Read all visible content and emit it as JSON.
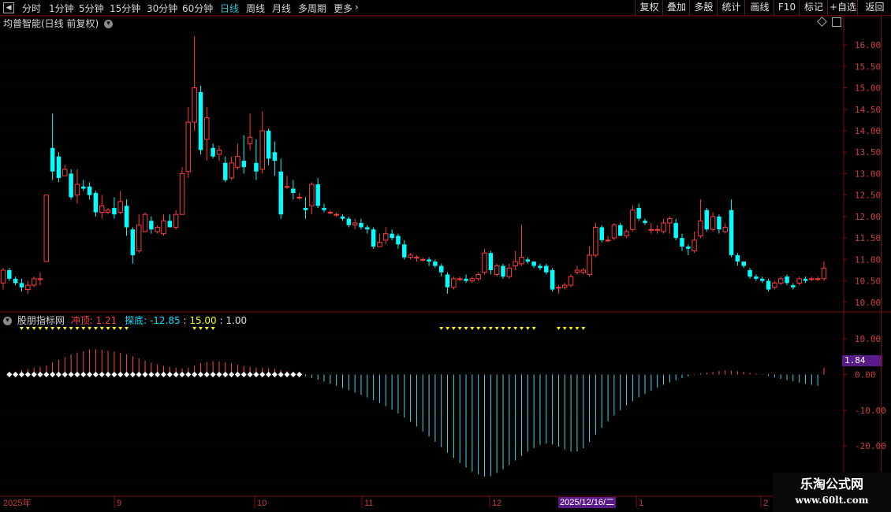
{
  "toolbar": {
    "periods": [
      "分时",
      "1分钟",
      "5分钟",
      "15分钟",
      "30分钟",
      "60分钟",
      "日线",
      "周线",
      "月线",
      "多周期",
      "更多"
    ],
    "active_period": "日线",
    "more_arrow": "›",
    "right_buttons": [
      "复权",
      "叠加",
      "多股",
      "统计",
      "画线",
      "F10",
      "标记",
      "+自选",
      "返回"
    ]
  },
  "main_panel": {
    "title": "均普智能(日线 前复权)",
    "y_ticks": [
      "16.00",
      "15.50",
      "15.00",
      "14.50",
      "14.00",
      "13.50",
      "13.00",
      "12.50",
      "12.00",
      "11.50",
      "11.00",
      "10.50",
      "10.00"
    ]
  },
  "indicator_panel": {
    "name": "股朋指标网",
    "label1": "冲顶:",
    "value1": "1.21",
    "label2": "探底:",
    "value2": "-12.85",
    "value3": ": 15.00",
    "value4": ": 1.00",
    "y_ticks": [
      "10.00",
      "0.00",
      "-10.00",
      "-20.00",
      "-30.00"
    ],
    "current_value": "1.84"
  },
  "x_axis": {
    "labels": [
      "2025年",
      "9",
      "10",
      "11",
      "12",
      "1",
      "2"
    ],
    "cursor_date": "2025/12/16/二"
  },
  "watermark": {
    "line1": "乐淘公式网",
    "line2": "www.60lt.com"
  },
  "colors": {
    "up": "#ff3c3c",
    "down": "#00ffff",
    "grid": "#3a0000",
    "frame": "#7a1010",
    "axis_text": "#c84040",
    "yellow": "#ffff00",
    "active_tab": "#27c6d6"
  },
  "chart_data": {
    "type": "candlestick",
    "y_range": [
      9.85,
      16.35
    ],
    "candles": [
      [
        10.45,
        10.75,
        10.8,
        10.3
      ],
      [
        10.75,
        10.55,
        10.8,
        10.5
      ],
      [
        10.55,
        10.45,
        10.6,
        10.4
      ],
      [
        10.45,
        10.35,
        10.55,
        10.25
      ],
      [
        10.3,
        10.4,
        10.5,
        10.2
      ],
      [
        10.4,
        10.55,
        10.6,
        10.35
      ],
      [
        10.55,
        10.55,
        10.7,
        10.4
      ],
      [
        10.95,
        12.5,
        12.5,
        10.95
      ],
      [
        13.6,
        13.05,
        14.4,
        12.85
      ],
      [
        13.4,
        12.9,
        13.5,
        12.8
      ],
      [
        12.95,
        13.1,
        13.2,
        12.95
      ],
      [
        13.0,
        12.45,
        13.1,
        12.4
      ],
      [
        12.5,
        12.75,
        13.1,
        12.3
      ],
      [
        12.7,
        12.65,
        12.85,
        12.6
      ],
      [
        12.7,
        12.5,
        12.8,
        12.4
      ],
      [
        12.55,
        12.1,
        12.6,
        12.0
      ],
      [
        12.1,
        12.25,
        12.5,
        11.95
      ],
      [
        12.1,
        12.15,
        12.2,
        12.05
      ],
      [
        12.2,
        12.05,
        12.45,
        11.95
      ],
      [
        12.1,
        12.35,
        12.6,
        12.05
      ],
      [
        12.25,
        11.75,
        12.4,
        11.55
      ],
      [
        11.7,
        11.1,
        11.75,
        10.9
      ],
      [
        11.2,
        11.8,
        12.05,
        11.15
      ],
      [
        11.65,
        12.05,
        12.1,
        11.65
      ],
      [
        11.9,
        11.7,
        12.0,
        11.6
      ],
      [
        11.65,
        11.75,
        11.8,
        11.6
      ],
      [
        11.6,
        11.9,
        12.05,
        11.55
      ],
      [
        11.9,
        11.75,
        12.05,
        11.75
      ],
      [
        11.75,
        12.05,
        12.15,
        11.7
      ],
      [
        12.05,
        13.0,
        13.15,
        12.05
      ],
      [
        13.05,
        14.2,
        14.55,
        12.9
      ],
      [
        14.2,
        15.0,
        16.2,
        14.0
      ],
      [
        14.9,
        13.55,
        15.05,
        13.45
      ],
      [
        13.8,
        14.3,
        14.55,
        13.3
      ],
      [
        13.6,
        13.4,
        13.7,
        13.35
      ],
      [
        13.45,
        13.55,
        13.65,
        13.3
      ],
      [
        13.25,
        12.85,
        13.4,
        12.8
      ],
      [
        12.9,
        13.25,
        13.4,
        12.85
      ],
      [
        13.15,
        13.4,
        13.7,
        13.1
      ],
      [
        13.3,
        13.15,
        13.9,
        13.0
      ],
      [
        13.7,
        13.85,
        14.4,
        13.55
      ],
      [
        13.25,
        13.05,
        13.8,
        12.85
      ],
      [
        13.1,
        14.0,
        14.45,
        13.0
      ],
      [
        14.0,
        13.35,
        14.05,
        13.2
      ],
      [
        13.5,
        13.3,
        13.75,
        12.95
      ],
      [
        13.05,
        12.05,
        13.35,
        11.95
      ],
      [
        12.7,
        12.7,
        12.95,
        12.65
      ],
      [
        12.65,
        12.55,
        12.85,
        12.4
      ],
      [
        12.45,
        12.45,
        12.55,
        12.4
      ],
      [
        12.2,
        12.15,
        12.45,
        11.95
      ],
      [
        12.25,
        12.75,
        12.8,
        12.05
      ],
      [
        12.75,
        12.25,
        12.9,
        12.2
      ],
      [
        12.2,
        12.15,
        12.3,
        12.1
      ],
      [
        12.1,
        12.1,
        12.15,
        12.05
      ],
      [
        12.05,
        12.05,
        12.1,
        12.0
      ],
      [
        12.0,
        11.95,
        12.05,
        11.9
      ],
      [
        11.95,
        11.8,
        12.0,
        11.75
      ],
      [
        11.8,
        11.85,
        11.95,
        11.7
      ],
      [
        11.85,
        11.75,
        11.95,
        11.7
      ],
      [
        11.75,
        11.7,
        11.8,
        11.6
      ],
      [
        11.7,
        11.3,
        11.75,
        11.25
      ],
      [
        11.3,
        11.4,
        11.6,
        11.3
      ],
      [
        11.45,
        11.6,
        11.75,
        11.35
      ],
      [
        11.6,
        11.5,
        11.7,
        11.45
      ],
      [
        11.55,
        11.35,
        11.6,
        11.25
      ],
      [
        11.35,
        11.05,
        11.45,
        11.0
      ],
      [
        11.05,
        11.1,
        11.15,
        11.0
      ],
      [
        11.05,
        11.05,
        11.1,
        10.95
      ],
      [
        11.0,
        11.0,
        11.05,
        10.95
      ],
      [
        11.0,
        10.95,
        11.05,
        10.85
      ],
      [
        10.95,
        10.85,
        11.0,
        10.8
      ],
      [
        10.85,
        10.7,
        10.9,
        10.6
      ],
      [
        10.65,
        10.35,
        10.7,
        10.2
      ],
      [
        10.35,
        10.55,
        10.6,
        10.3
      ],
      [
        10.55,
        10.55,
        10.6,
        10.5
      ],
      [
        10.55,
        10.5,
        10.65,
        10.45
      ],
      [
        10.5,
        10.55,
        10.6,
        10.45
      ],
      [
        10.55,
        10.65,
        10.7,
        10.5
      ],
      [
        10.7,
        11.15,
        11.25,
        10.65
      ],
      [
        11.15,
        10.75,
        11.2,
        10.65
      ],
      [
        10.65,
        10.85,
        10.9,
        10.6
      ],
      [
        10.85,
        10.6,
        10.9,
        10.55
      ],
      [
        10.6,
        10.8,
        10.9,
        10.55
      ],
      [
        10.85,
        10.95,
        11.2,
        10.75
      ],
      [
        10.9,
        11.05,
        11.8,
        10.85
      ],
      [
        11.0,
        10.95,
        11.05,
        10.9
      ],
      [
        10.95,
        10.85,
        10.95,
        10.8
      ],
      [
        10.85,
        10.8,
        10.9,
        10.75
      ],
      [
        10.85,
        10.7,
        10.9,
        10.65
      ],
      [
        10.75,
        10.3,
        10.8,
        10.25
      ],
      [
        10.35,
        10.35,
        10.4,
        10.2
      ],
      [
        10.35,
        10.4,
        10.45,
        10.3
      ],
      [
        10.4,
        10.6,
        10.65,
        10.35
      ],
      [
        10.7,
        10.75,
        10.85,
        10.65
      ],
      [
        10.7,
        10.75,
        10.8,
        10.65
      ],
      [
        10.65,
        11.1,
        11.3,
        10.6
      ],
      [
        11.1,
        11.75,
        11.85,
        11.05
      ],
      [
        11.75,
        11.45,
        11.8,
        11.4
      ],
      [
        11.45,
        11.45,
        11.55,
        11.4
      ],
      [
        11.5,
        11.8,
        11.85,
        11.45
      ],
      [
        11.8,
        11.55,
        11.85,
        11.55
      ],
      [
        11.55,
        11.65,
        11.7,
        11.5
      ],
      [
        11.7,
        12.15,
        12.25,
        11.65
      ],
      [
        12.2,
        11.95,
        12.3,
        11.9
      ],
      [
        11.9,
        11.85,
        11.95,
        11.8
      ],
      [
        11.7,
        11.7,
        11.85,
        11.6
      ],
      [
        11.7,
        11.7,
        11.8,
        11.6
      ],
      [
        11.65,
        11.85,
        11.95,
        11.6
      ],
      [
        11.85,
        11.95,
        12.0,
        11.6
      ],
      [
        11.85,
        11.5,
        11.95,
        11.45
      ],
      [
        11.5,
        11.3,
        11.6,
        11.2
      ],
      [
        11.3,
        11.25,
        11.35,
        11.1
      ],
      [
        11.2,
        11.45,
        11.65,
        11.15
      ],
      [
        11.55,
        11.9,
        12.4,
        11.5
      ],
      [
        12.15,
        11.7,
        12.2,
        11.65
      ],
      [
        11.7,
        12.0,
        12.1,
        11.65
      ],
      [
        12.0,
        11.7,
        12.05,
        11.6
      ],
      [
        11.65,
        11.75,
        11.85,
        11.6
      ],
      [
        12.15,
        11.1,
        12.4,
        11.05
      ],
      [
        11.1,
        10.95,
        11.15,
        10.85
      ],
      [
        10.95,
        10.85,
        10.95,
        10.8
      ],
      [
        10.75,
        10.6,
        10.8,
        10.55
      ],
      [
        10.6,
        10.55,
        10.65,
        10.5
      ],
      [
        10.55,
        10.5,
        10.6,
        10.45
      ],
      [
        10.5,
        10.3,
        10.55,
        10.25
      ],
      [
        10.35,
        10.45,
        10.5,
        10.3
      ],
      [
        10.45,
        10.55,
        10.6,
        10.4
      ],
      [
        10.6,
        10.45,
        10.65,
        10.4
      ],
      [
        10.4,
        10.35,
        10.45,
        10.3
      ],
      [
        10.45,
        10.55,
        10.6,
        10.4
      ],
      [
        10.55,
        10.5,
        10.6,
        10.45
      ],
      [
        10.55,
        10.55,
        10.6,
        10.5
      ],
      [
        10.55,
        10.55,
        10.6,
        10.5
      ],
      [
        10.55,
        10.8,
        10.95,
        10.5
      ]
    ],
    "indicator_series": [
      {
        "name": "冲顶",
        "values": [
          1.21,
          2.1,
          2.38,
          2.62,
          2.53,
          2.83,
          2.56,
          3.39,
          4.85,
          5.44,
          5.56,
          6.22,
          6.09,
          6.06,
          6.34,
          4.96,
          4.37,
          3.35,
          3.22,
          3.13,
          2.94,
          2.2,
          1.52,
          0.92,
          0.56,
          0.41,
          0.67,
          0.95,
          1.17,
          1.72,
          2.32,
          3.08,
          3.19,
          3.1,
          2.54,
          1.84,
          1.22,
          0.73,
          0.41,
          0.36,
          0.46,
          0.8,
          1.16,
          1.2,
          1.07,
          0.77,
          0.49,
          0.37,
          0.35,
          0.46,
          0.61,
          0.56,
          0.38,
          0.11,
          -0.26,
          -0.53,
          -0.82,
          -1.13,
          -1.23,
          -1.44,
          -1.81,
          -2.31,
          -2.74,
          -3.25,
          -3.78,
          -4.44,
          -5.19,
          -5.98,
          -6.84,
          -7.73,
          -8.6,
          -9.61,
          -10.78,
          -12.02,
          -13.18,
          -14.08,
          -14.89,
          -15.47,
          -15.55,
          -14.84,
          -14.08,
          -13.62,
          -12.85,
          -11.82,
          -10.89,
          -10.31,
          -10.08,
          -10.34,
          -11.13,
          -12.32,
          -13.33,
          -13.97,
          -14.01,
          -13.22,
          -11.78,
          -9.95,
          -8.24,
          -6.79,
          -5.75,
          -4.94,
          -4.48,
          -4.22,
          -4.11,
          -4.18,
          -4.31,
          -4.42,
          -4.45,
          -4.34,
          -4.15,
          -4.06,
          -4.01,
          -3.98,
          -3.99,
          -4.09,
          -4.13,
          -4.15,
          -4.11,
          -4.08,
          -4.03,
          -4.08,
          -4.06,
          -4.09,
          -4.26,
          -4.56,
          -4.96,
          -5.47,
          -5.93,
          -6.39,
          -6.88,
          -7.42,
          -7.69,
          -7.86,
          -7.91,
          -1.75
        ]
      },
      {
        "name": "探底",
        "values": [
          -0.01,
          0.31,
          0.77,
          1.23,
          1.52,
          1.87,
          2.12,
          2.54,
          3.38,
          4.11,
          4.86,
          5.6,
          6.15,
          6.55,
          7.08,
          7.1,
          6.96,
          6.68,
          6.4,
          6.06,
          5.66,
          5.14,
          4.56,
          3.92,
          3.34,
          2.88,
          2.42,
          2.14,
          1.88,
          1.71,
          1.93,
          2.44,
          3.18,
          3.56,
          3.69,
          3.62,
          3.45,
          3.13,
          2.75,
          2.37,
          2.12,
          1.92,
          1.91,
          1.8,
          1.65,
          1.31,
          0.91,
          0.46,
          0.01,
          -0.5,
          -0.98,
          -1.46,
          -1.99,
          -2.54,
          -3.15,
          -3.77,
          -4.41,
          -5.05,
          -5.71,
          -6.44,
          -7.19,
          -7.98,
          -8.83,
          -9.82,
          -10.92,
          -12.06,
          -13.28,
          -14.58,
          -15.95,
          -17.37,
          -18.84,
          -20.34,
          -21.89,
          -23.39,
          -24.79,
          -26.06,
          -27.16,
          -28.02,
          -28.57,
          -28.51,
          -27.6,
          -26.54,
          -25.39,
          -24.08,
          -22.81,
          -21.61,
          -20.57,
          -19.74,
          -19.4,
          -19.61,
          -20.21,
          -20.99,
          -21.59,
          -21.57,
          -20.64,
          -18.91,
          -16.82,
          -14.9,
          -13.09,
          -11.47,
          -9.98,
          -8.66,
          -7.49,
          -6.41,
          -5.49,
          -4.57,
          -3.71,
          -2.88,
          -2.26,
          -1.62,
          -1.03,
          -0.54,
          -0.08,
          0.33,
          0.56,
          0.74,
          0.95,
          1.12,
          1.09,
          0.94,
          0.77,
          0.54,
          0.28,
          -0.1,
          -0.47,
          -0.82,
          -1.21,
          -1.55,
          -1.9,
          -2.27,
          -2.6,
          -2.88,
          -3.16,
          1.84
        ]
      }
    ],
    "indicator_range": [
      -33,
      14
    ]
  }
}
